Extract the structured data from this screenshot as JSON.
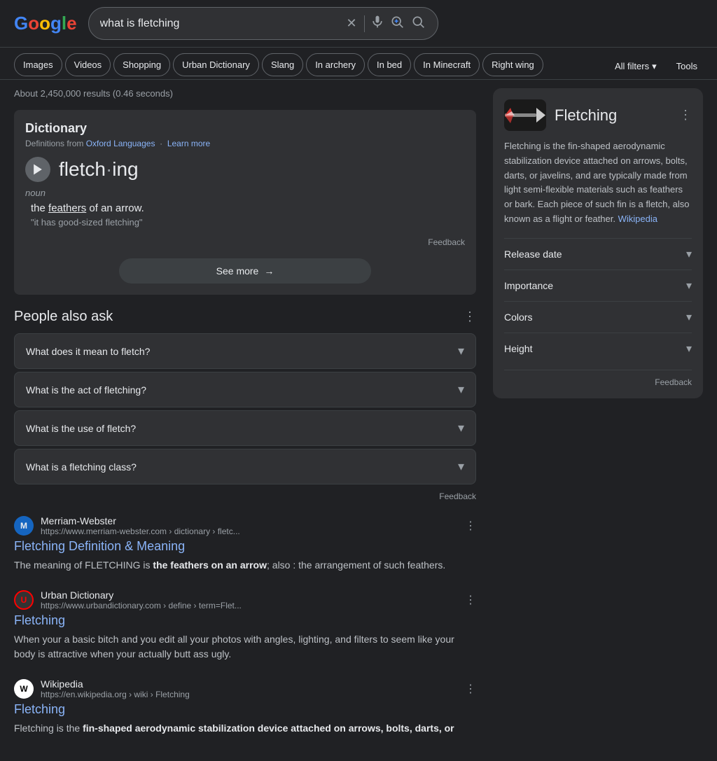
{
  "header": {
    "logo": {
      "g1": "G",
      "o1": "o",
      "o2": "o",
      "g2": "g",
      "l": "l",
      "e": "e"
    },
    "search_query": "what is fletching",
    "clear_label": "✕",
    "mic_label": "🎤",
    "lens_label": "🔍",
    "search_label": "⌕"
  },
  "nav": {
    "tabs": [
      {
        "label": "Images",
        "id": "images"
      },
      {
        "label": "Videos",
        "id": "videos"
      },
      {
        "label": "Shopping",
        "id": "shopping"
      },
      {
        "label": "Urban Dictionary",
        "id": "urban-dict"
      },
      {
        "label": "Slang",
        "id": "slang"
      },
      {
        "label": "In archery",
        "id": "in-archery"
      },
      {
        "label": "In bed",
        "id": "in-bed"
      },
      {
        "label": "In Minecraft",
        "id": "in-minecraft"
      },
      {
        "label": "Right wing",
        "id": "right-wing"
      }
    ],
    "all_filters_label": "All filters",
    "tools_label": "Tools"
  },
  "results": {
    "count_text": "About 2,450,000 results (0.46 seconds)",
    "dictionary": {
      "title": "Dictionary",
      "source_text": "Definitions from",
      "source_link_text": "Oxford Languages",
      "source_link_url": "#",
      "learn_more_text": "Learn more",
      "word_parts": [
        "fletch",
        "·",
        "ing"
      ],
      "pos": "noun",
      "definition": "the feathers of an arrow.",
      "definition_highlighted_word": "feathers",
      "example": "\"it has good-sized fletching\"",
      "feedback_label": "Feedback",
      "see_more_label": "See more",
      "arrow_icon": "→"
    },
    "people_also_ask": {
      "title": "People also ask",
      "items": [
        {
          "question": "What does it mean to fletch?"
        },
        {
          "question": "What is the act of fletching?"
        },
        {
          "question": "What is the use of fletch?"
        },
        {
          "question": "What is a fletching class?"
        }
      ],
      "feedback_label": "Feedback"
    },
    "items": [
      {
        "id": "merriam-webster",
        "site_name": "Merriam-Webster",
        "url": "https://www.merriam-webster.com › dictionary › fletc...",
        "favicon_text": "M",
        "title": "Fletching Definition & Meaning",
        "snippet": "The meaning of FLETCHING is <b>the feathers on an arrow</b>; also : the arrangement of such feathers."
      },
      {
        "id": "urban-dictionary",
        "site_name": "Urban Dictionary",
        "url": "https://www.urbandictionary.com › define › term=Flet...",
        "favicon_text": "U",
        "title": "Fletching",
        "snippet": "When your a basic bitch and you edit all your photos with angles, lighting, and filters to seem like your body is attractive when your actually butt ass ugly."
      },
      {
        "id": "wikipedia",
        "site_name": "Wikipedia",
        "url": "https://en.wikipedia.org › wiki › Fletching",
        "favicon_text": "W",
        "title": "Fletching",
        "snippet": "Fletching is the <b>fin-shaped aerodynamic stabilization device attached on arrows, bolts, darts, or</b>"
      }
    ]
  },
  "right_panel": {
    "title": "Fletching",
    "description": "Fletching is the fin-shaped aerodynamic stabilization device attached on arrows, bolts, darts, or javelins, and are typically made from light semi-flexible materials such as feathers or bark. Each piece of such fin is a fletch, also known as a flight or feather.",
    "wikipedia_link": "Wikipedia",
    "sections": [
      {
        "label": "Release date"
      },
      {
        "label": "Importance"
      },
      {
        "label": "Colors"
      },
      {
        "label": "Height"
      }
    ],
    "feedback_label": "Feedback"
  }
}
